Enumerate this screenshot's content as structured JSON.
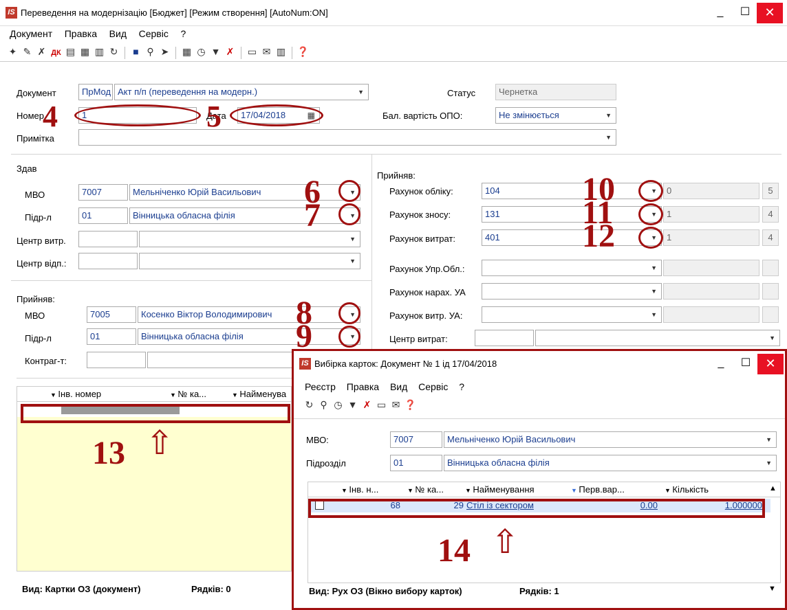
{
  "main": {
    "title": "Переведення на модернізацію [Бюджет] [Режим створення] [AutoNum:ON]",
    "menu": [
      "Документ",
      "Правка",
      "Вид",
      "Сервіс",
      "?"
    ],
    "document": {
      "label": "Документ",
      "code": "ПрМод",
      "type": "Акт п/п (переведення на модерн.)"
    },
    "status": {
      "label": "Статус",
      "value": "Чернетка"
    },
    "number": {
      "label": "Номер",
      "value": "1"
    },
    "date": {
      "label": "Дата",
      "value": "17/04/2018"
    },
    "bal": {
      "label": "Бал. вартість ОПО:",
      "value": "Не змінюється"
    },
    "note": {
      "label": "Примітка",
      "value": ""
    },
    "gave": {
      "title": "Здав",
      "mvo_label": "МВО",
      "mvo_code": "7007",
      "mvo_name": "Мельніченко Юрій Васильович",
      "dept_label": "Підр-л",
      "dept_code": "01",
      "dept_name": "Вінницька обласна філія",
      "cc_label": "Центр витр.",
      "cr_label": "Центр відп.:"
    },
    "recv": {
      "title": "Прийняв:",
      "mvo_label": "МВО",
      "mvo_code": "7005",
      "mvo_name": "Косенко Віктор Володимирович",
      "dept_label": "Підр-л",
      "dept_code": "01",
      "dept_name": "Вінницька обласна філія",
      "cp_label": "Контраг-т:"
    },
    "accounts": {
      "title": "Прийняв:",
      "rows": [
        {
          "label": "Рахунок обліку:",
          "value": "104",
          "n": "0",
          "m": "5"
        },
        {
          "label": "Рахунок зносу:",
          "value": "131",
          "n": "1",
          "m": "4"
        },
        {
          "label": "Рахунок витрат:",
          "value": "401",
          "n": "1",
          "m": "4"
        },
        {
          "label": "Рахунок Упр.Обл.:",
          "value": "",
          "n": "",
          "m": ""
        },
        {
          "label": "Рахунок нарах. УА",
          "value": "",
          "n": "",
          "m": ""
        },
        {
          "label": "Рахунок витр. УА:",
          "value": "",
          "n": "",
          "m": ""
        }
      ],
      "cc_label": "Центр витрат:"
    },
    "grid": {
      "cols": [
        "Інв. номер",
        "№ ка...",
        "Найменува"
      ]
    },
    "footer": {
      "view": "Вид: Картки ОЗ (документ)",
      "rows": "Рядків: 0"
    }
  },
  "dialog": {
    "title": "Вибірка карток: Документ №  1     ід  17/04/2018",
    "menu": [
      "Реєстр",
      "Правка",
      "Вид",
      "Сервіс",
      "?"
    ],
    "mvo_label": "МВО:",
    "mvo_code": "7007",
    "mvo_name": "Мельніченко Юрій Васильович",
    "dept_label": "Підрозділ",
    "dept_code": "01",
    "dept_name": "Вінницька обласна філія",
    "cols": [
      "Інв. н...",
      "№ ка...",
      "Найменування",
      "Перв.вар...",
      "Кількість"
    ],
    "row": {
      "inv": "68",
      "card": "29",
      "name": "Стіл із сектором",
      "cost": "0.00",
      "qty": "1.000000"
    },
    "footer": {
      "view": "Вид: Рух ОЗ (Вікно вибору карток)",
      "rows": "Рядків: 1"
    }
  },
  "annotations": [
    "4",
    "5",
    "6",
    "7",
    "8",
    "9",
    "10",
    "11",
    "12",
    "13",
    "14"
  ],
  "colors": {
    "annotation": "#a01010",
    "grid_bg": "#ffffd0",
    "selected_row": "#dbe8fb"
  }
}
